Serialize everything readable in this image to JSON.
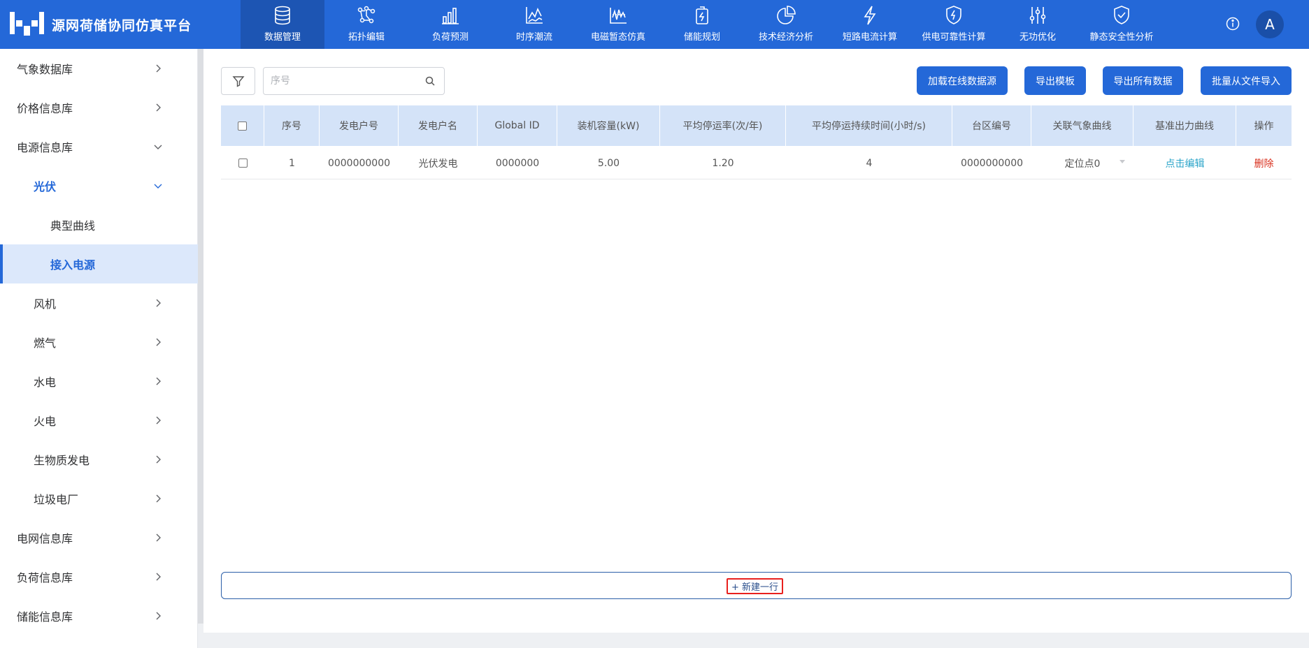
{
  "app": {
    "title": "源网荷储协同仿真平台",
    "avatar_initial": "A",
    "accent_color": "#2468d8"
  },
  "nav": [
    {
      "label": "数据管理",
      "icon": "database-icon",
      "active": true
    },
    {
      "label": "拓扑编辑",
      "icon": "topology-icon"
    },
    {
      "label": "负荷预测",
      "icon": "bar-chart-icon"
    },
    {
      "label": "时序潮流",
      "icon": "line-chart-icon"
    },
    {
      "label": "电磁暂态仿真",
      "icon": "waveform-icon"
    },
    {
      "label": "储能规划",
      "icon": "battery-icon"
    },
    {
      "label": "技术经济分析",
      "icon": "pie-chart-icon"
    },
    {
      "label": "短路电流计算",
      "icon": "lightning-icon"
    },
    {
      "label": "供电可靠性计算",
      "icon": "shield-bolt-icon"
    },
    {
      "label": "无功优化",
      "icon": "sliders-icon"
    },
    {
      "label": "静态安全性分析",
      "icon": "shield-check-icon"
    }
  ],
  "sidebar": {
    "items": [
      {
        "label": "气象数据库",
        "level": 1,
        "chevron": "right"
      },
      {
        "label": "价格信息库",
        "level": 1,
        "chevron": "right"
      },
      {
        "label": "电源信息库",
        "level": 1,
        "chevron": "down"
      },
      {
        "label": "光伏",
        "level": 2,
        "chevron": "down",
        "state": "open"
      },
      {
        "label": "典型曲线",
        "level": 3
      },
      {
        "label": "接入电源",
        "level": 3,
        "state": "selected"
      },
      {
        "label": "风机",
        "level": 2,
        "chevron": "right"
      },
      {
        "label": "燃气",
        "level": 2,
        "chevron": "right"
      },
      {
        "label": "水电",
        "level": 2,
        "chevron": "right"
      },
      {
        "label": "火电",
        "level": 2,
        "chevron": "right"
      },
      {
        "label": "生物质发电",
        "level": 2,
        "chevron": "right"
      },
      {
        "label": "垃圾电厂",
        "level": 2,
        "chevron": "right"
      },
      {
        "label": "电网信息库",
        "level": 1,
        "chevron": "right"
      },
      {
        "label": "负荷信息库",
        "level": 1,
        "chevron": "right"
      },
      {
        "label": "储能信息库",
        "level": 1,
        "chevron": "right"
      }
    ]
  },
  "toolbar": {
    "search_placeholder": "序号",
    "buttons": [
      "加载在线数据源",
      "导出模板",
      "导出所有数据",
      "批量从文件导入"
    ]
  },
  "table": {
    "columns": [
      "",
      "序号",
      "发电户号",
      "发电户名",
      "Global ID",
      "装机容量(kW)",
      "平均停运率(次/年)",
      "平均停运持续时间(小时/s)",
      "台区编号",
      "关联气象曲线",
      "基准出力曲线",
      "操作"
    ],
    "rows": [
      {
        "seq": "1",
        "gen_no": "0000000000",
        "gen_name": "光伏发电",
        "global_id": "0000000",
        "capacity": "5.00",
        "outage_rate": "1.20",
        "outage_duration": "4",
        "area_no": "0000000000",
        "weather_curve": "定位点0",
        "base_curve": "点击编辑",
        "action": "删除"
      }
    ]
  },
  "add_row_label": "+ 新建一行"
}
